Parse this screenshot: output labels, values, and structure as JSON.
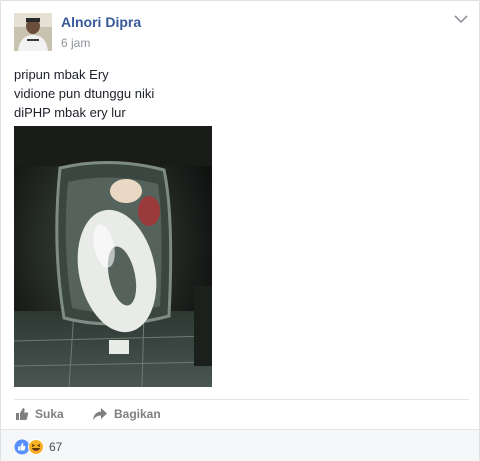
{
  "post": {
    "author": "Alnori Dipra",
    "timestamp": "6 jam",
    "text_lines": [
      "pripun mbak Ery",
      "vidione pun dtunggu niki",
      "diPHP mbak ery lur"
    ]
  },
  "actions": {
    "like_label": "Suka",
    "share_label": "Bagikan"
  },
  "reactions": {
    "count": "67",
    "types": [
      "like-icon",
      "haha-icon"
    ]
  },
  "colors": {
    "link": "#365899",
    "like_blue": "#5890ff",
    "haha_yellow": "#f7b125"
  }
}
